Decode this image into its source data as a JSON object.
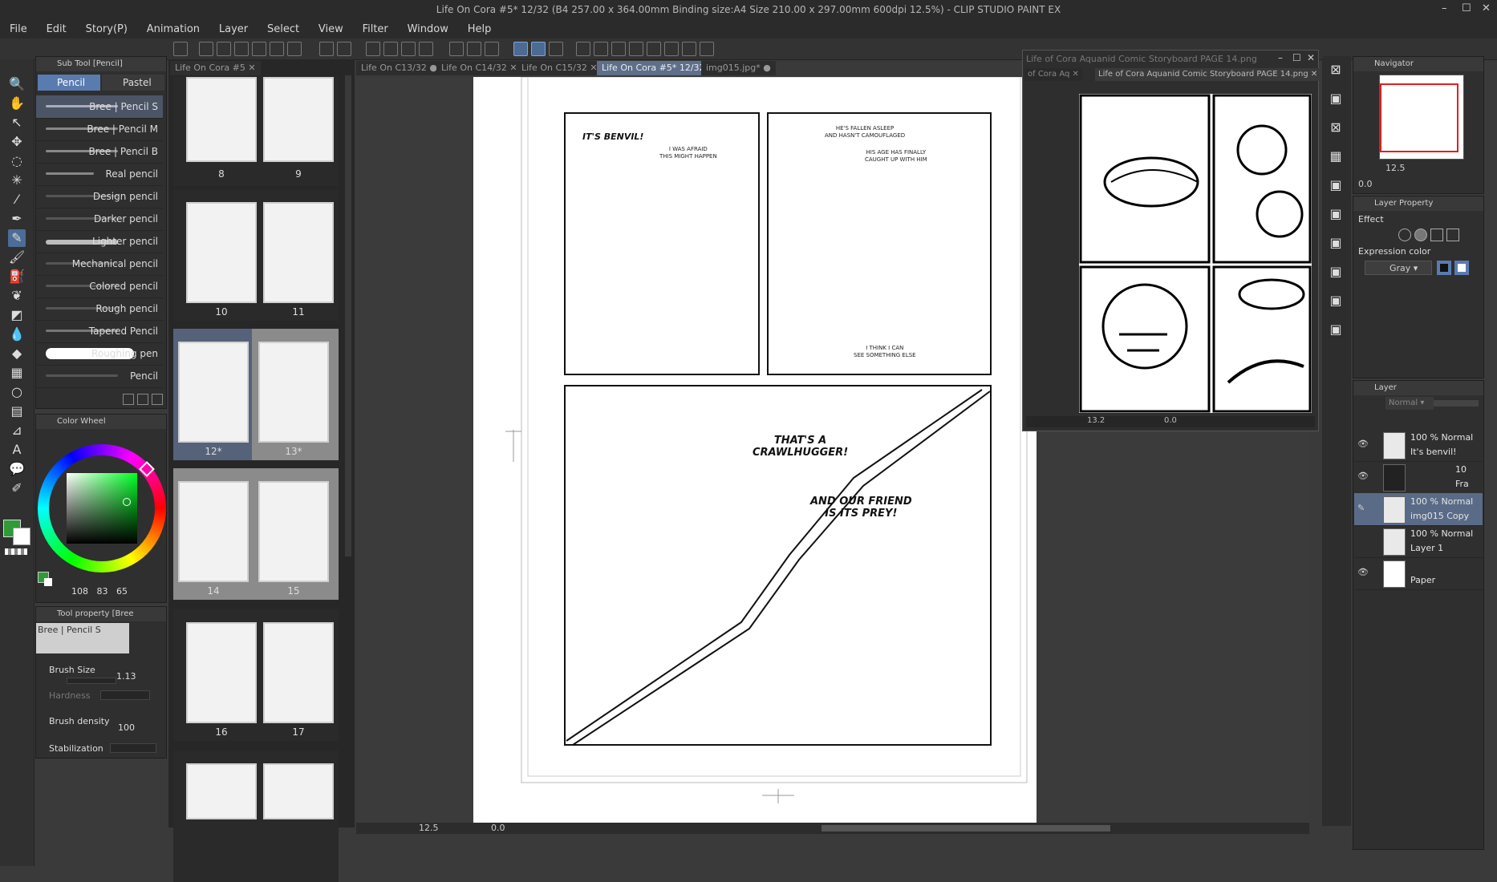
{
  "window": {
    "title": "Life On Cora #5* 12/32 (B4 257.00 x 364.00mm Binding size:A4 Size 210.00 x 297.00mm 600dpi 12.5%) - CLIP STUDIO PAINT EX",
    "minimize": "–",
    "maximize": "☐",
    "close": "✕"
  },
  "menu": [
    "File",
    "Edit",
    "Story(P)",
    "Animation",
    "Layer",
    "Select",
    "View",
    "Filter",
    "Window",
    "Help"
  ],
  "subtool": {
    "header": "Sub Tool [Pencil]",
    "tabs": [
      "Pencil",
      "Pastel"
    ],
    "brushes": [
      "Bree | Pencil S",
      "Bree | Pencil M",
      "Bree | Pencil B",
      "Real pencil",
      "Design pencil",
      "Darker pencil",
      "Lighter pencil",
      "Mechanical pencil",
      "Colored pencil",
      "Rough pencil",
      "Tapered Pencil",
      "Roughing pen",
      "Pencil"
    ]
  },
  "color_wheel": {
    "header": "Color Wheel",
    "main_color": "#2e9a3a",
    "values": [
      "108",
      "83",
      "65"
    ]
  },
  "tool_property": {
    "header": "Tool property [Bree",
    "preset": "Bree | Pencil S",
    "brush_size_label": "Brush Size",
    "brush_size": "1.13",
    "hardness_label": "Hardness",
    "brush_density_label": "Brush density",
    "brush_density": "100",
    "stabilization_label": "Stabilization"
  },
  "page_manager": {
    "tab": "Life On Cora #5",
    "pages": [
      "8",
      "9",
      "10",
      "11",
      "12*",
      "13*",
      "14",
      "15",
      "16",
      "17"
    ]
  },
  "doc_tabs": [
    {
      "label": "Life On C​13/32",
      "active": false
    },
    {
      "label": "Life On C​14/32",
      "active": false
    },
    {
      "label": "Life On C​15/32",
      "active": false
    },
    {
      "label": "Life On Cora #5* 12/32",
      "active": true
    },
    {
      "label": "img015.jpg*",
      "active": false
    }
  ],
  "canvas": {
    "zoom": "12.5",
    "angle": "0.0",
    "text": {
      "benvil": "IT'S BENVIL!",
      "afraid": "I WAS AFRAID\nTHIS MIGHT HAPPEN",
      "asleep": "HE'S FALLEN ASLEEP\nAND HASN'T CAMOUFLAGED",
      "age": "HIS AGE HAS FINALLY\nCAUGHT UP WITH HIM",
      "else": "I THINK I CAN\nSEE SOMETHING ELSE",
      "crawl": "THAT'S A\nCRAWLHUGGER!",
      "prey": "AND OUR FRIEND\nIS ITS PREY!"
    }
  },
  "sub_view": {
    "title": "Life of Cora Aquanid Comic Storyboard PAGE 14.png",
    "tab1": "of Cora Aq​",
    "tab2": "Life of Cora Aquanid Comic Storyboard PAGE 14.png",
    "zoom": "13.2",
    "angle": "0.0"
  },
  "navigator": {
    "header": "Navigator",
    "zoom": "12.5",
    "angle": "0.0"
  },
  "layer_property": {
    "header": "Layer Property",
    "effect": "Effect",
    "expression_color": "Expression color",
    "color_mode": "Gray"
  },
  "layers": {
    "header": "Layer",
    "blend": "Normal",
    "items": [
      {
        "opacity": "100 % Normal",
        "name": "It's benvil!"
      },
      {
        "opacity": "10",
        "name": "Fra"
      },
      {
        "opacity": "100 % Normal",
        "name": "img015 Copy"
      },
      {
        "opacity": "100 % Normal",
        "name": "Layer 1"
      },
      {
        "opacity": "",
        "name": "Paper"
      }
    ]
  }
}
